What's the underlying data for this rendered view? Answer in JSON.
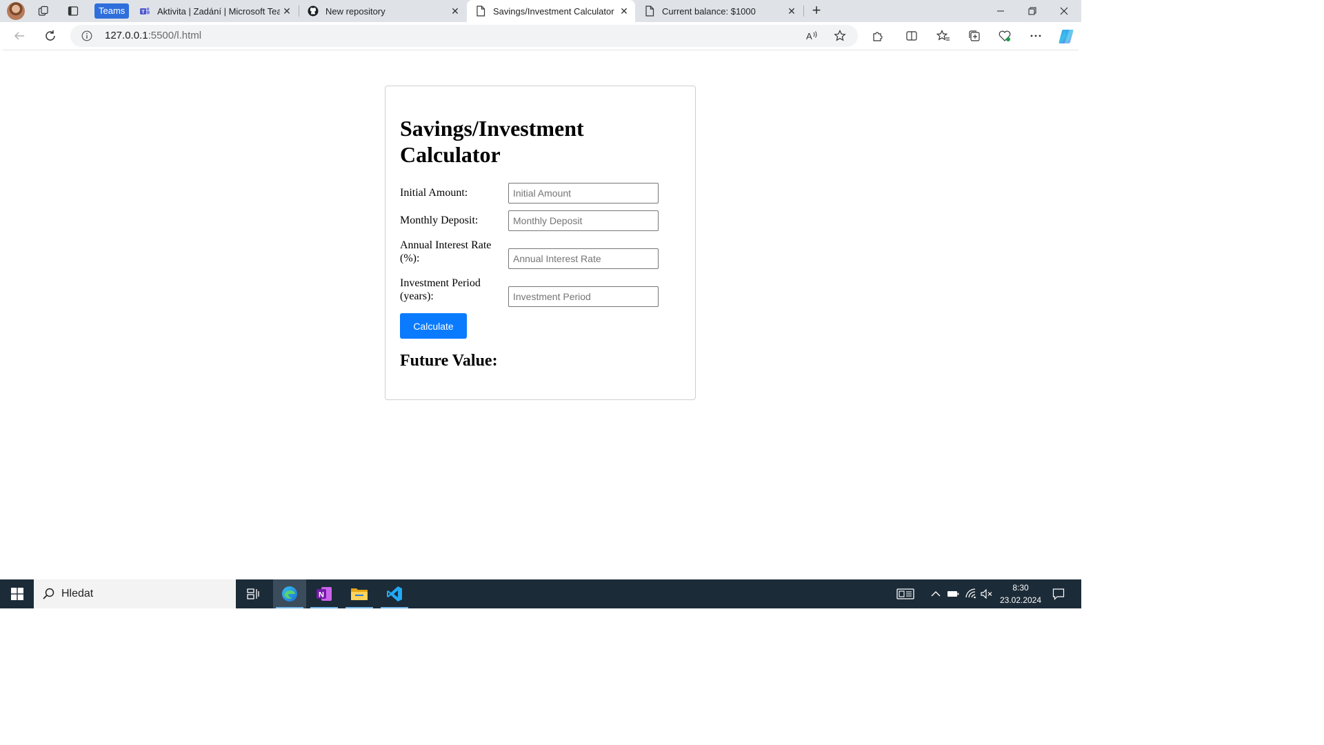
{
  "browser": {
    "teams_badge": "Teams",
    "tabs": [
      {
        "title": "Aktivita | Zadání | Microsoft Teams",
        "icon": "teams-icon",
        "close": "✕"
      },
      {
        "title": "New repository",
        "icon": "github-icon",
        "close": "✕"
      },
      {
        "title": "Savings/Investment Calculator",
        "icon": "page-icon",
        "close": "✕",
        "active": true
      },
      {
        "title": "Current balance: $1000",
        "icon": "page-icon",
        "close": "✕"
      }
    ],
    "address": {
      "host": "127.0.0.1",
      "path": ":5500/l.html"
    }
  },
  "calculator": {
    "title": "Savings/Investment Calculator",
    "fields": [
      {
        "label": "Initial Amount:",
        "placeholder": "Initial Amount",
        "value": ""
      },
      {
        "label": "Monthly Deposit:",
        "placeholder": "Monthly Deposit",
        "value": ""
      },
      {
        "label": "Annual Interest Rate (%):",
        "placeholder": "Annual Interest Rate",
        "value": ""
      },
      {
        "label": "Investment Period (years):",
        "placeholder": "Investment Period",
        "value": ""
      }
    ],
    "button_label": "Calculate",
    "result_heading": "Future Value:"
  },
  "taskbar": {
    "search_text": "Hledat",
    "time": "8:30",
    "date": "23.02.2024"
  },
  "colors": {
    "accent_button": "#0a7bff",
    "taskbar_bg": "#1c2b38",
    "tabbar_bg": "#dfe3e8"
  }
}
